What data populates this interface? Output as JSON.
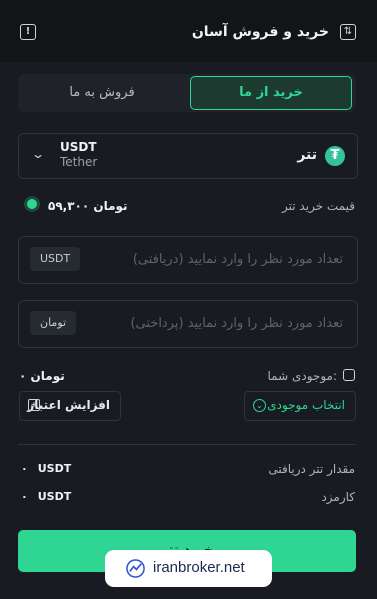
{
  "header": {
    "title": "خرید و فروش آسان"
  },
  "tabs": {
    "buy": "خرید از ما",
    "sell": "فروش به ما"
  },
  "coin": {
    "name": "تتر",
    "symbol": "USDT",
    "full_name": "Tether",
    "icon_glyph": "₮"
  },
  "price": {
    "label": "قیمت خرید تتر",
    "value": "۵۹,۳۰۰ تومان"
  },
  "receive_input": {
    "placeholder": "تعداد مورد نظر را وارد نمایید (دریافتی)",
    "unit": "USDT"
  },
  "pay_input": {
    "placeholder": "تعداد مورد نظر را وارد نمایید (پرداختی)",
    "unit": "تومان"
  },
  "balance": {
    "label": "موجودی شما:",
    "value": "۰ تومان",
    "select_button": "انتخاب موجودی",
    "credit_button": "افزایش اعتبار"
  },
  "summary": [
    {
      "label": "مقدار تتر دریافتی",
      "zero": "۰",
      "unit": "USDT"
    },
    {
      "label": "کارمزد",
      "zero": "۰",
      "unit": "USDT"
    }
  ],
  "cta": {
    "label": "خرید تتر"
  },
  "watermark": {
    "text": "iranbroker.net"
  },
  "colors": {
    "accent": "#2fd593",
    "background": "#121418",
    "panel": "#181b21"
  }
}
